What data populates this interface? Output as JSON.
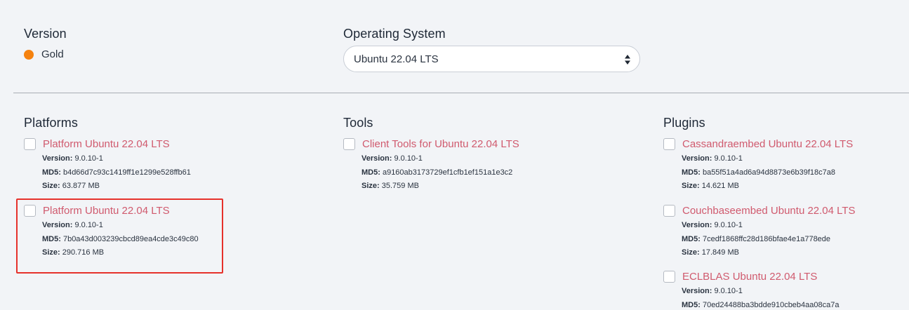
{
  "version": {
    "heading": "Version",
    "value": "Gold",
    "dot_color": "#f5820f"
  },
  "os": {
    "heading": "Operating System",
    "selected": "Ubuntu 22.04 LTS"
  },
  "meta_labels": {
    "version": "Version:",
    "md5": "MD5:",
    "size": "Size:"
  },
  "platforms": {
    "heading": "Platforms",
    "items": [
      {
        "title": "Platform Ubuntu 22.04 LTS",
        "version": "9.0.10-1",
        "md5": "b4d66d7c93c1419ff1e1299e528ffb61",
        "size": "63.877 MB"
      },
      {
        "title": "Platform Ubuntu 22.04 LTS",
        "version": "9.0.10-1",
        "md5": "7b0a43d003239cbcd89ea4cde3c49c80",
        "size": "290.716 MB"
      }
    ]
  },
  "tools": {
    "heading": "Tools",
    "items": [
      {
        "title": "Client Tools for Ubuntu 22.04 LTS",
        "version": "9.0.10-1",
        "md5": "a9160ab3173729ef1cfb1ef151a1e3c2",
        "size": "35.759 MB"
      }
    ]
  },
  "plugins": {
    "heading": "Plugins",
    "items": [
      {
        "title": "Cassandraembed Ubuntu 22.04 LTS",
        "version": "9.0.10-1",
        "md5": "ba55f51a4ad6a94d8873e6b39f18c7a8",
        "size": "14.621 MB"
      },
      {
        "title": "Couchbaseembed Ubuntu 22.04 LTS",
        "version": "9.0.10-1",
        "md5": "7cedf1868ffc28d186bfae4e1a778ede",
        "size": "17.849 MB"
      },
      {
        "title": "ECLBLAS Ubuntu 22.04 LTS",
        "version": "9.0.10-1",
        "md5": "70ed24488ba3bdde910cbeb4aa08ca7a",
        "size": ""
      }
    ]
  }
}
